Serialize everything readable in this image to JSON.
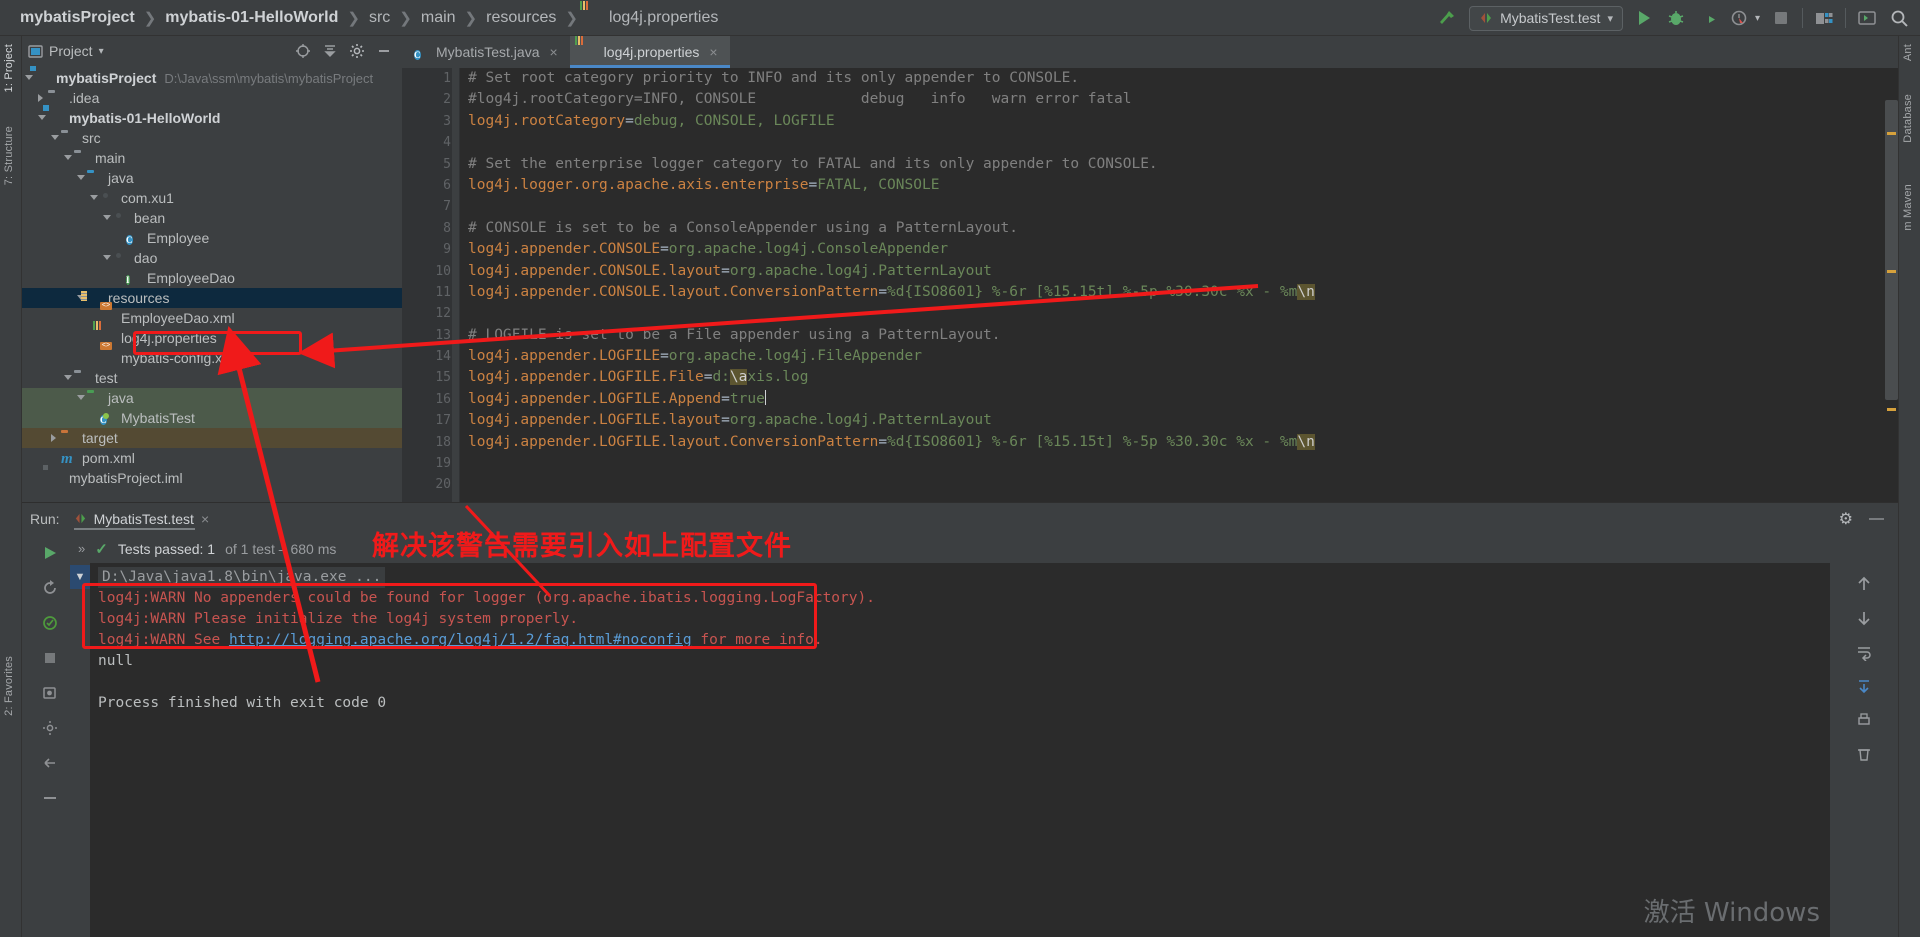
{
  "window": {
    "breadcrumbs": [
      {
        "label": "mybatisProject",
        "bold": true
      },
      {
        "label": "mybatis-01-HelloWorld",
        "bold": true
      },
      {
        "label": "src",
        "bold": false
      },
      {
        "label": "main",
        "bold": false
      },
      {
        "label": "resources",
        "bold": false
      },
      {
        "label": "log4j.properties",
        "bold": false,
        "icon": "properties-file-icon"
      }
    ],
    "separator": "❯"
  },
  "toolbar": {
    "build_label": "Build",
    "run_config": "MybatisTest.test",
    "dropdown_caret": "▾",
    "icons": [
      {
        "name": "build-hammer-icon",
        "color": "#4c9e4c"
      },
      {
        "name": "run-icon",
        "color": "#59a869"
      },
      {
        "name": "debug-icon",
        "color": "#59a869"
      },
      {
        "name": "run-with-coverage-icon",
        "color": "#8f9194"
      },
      {
        "name": "profiler-icon",
        "color": "#8f9194"
      },
      {
        "name": "stop-icon",
        "color": "#76797b"
      },
      {
        "name": "project-structure-icon",
        "color": "#8f9194"
      },
      {
        "name": "terminal-icon",
        "color": "#59a869"
      },
      {
        "name": "search-everywhere-icon",
        "color": "#b4b7ba"
      }
    ]
  },
  "left_strip": {
    "items": [
      {
        "label": "1: Project",
        "active": true
      },
      {
        "label": "7: Structure",
        "active": false
      },
      {
        "label": "2: Favorites",
        "active": false
      }
    ]
  },
  "right_strip": {
    "items": [
      {
        "label": "Ant",
        "active": false
      },
      {
        "label": "Database",
        "active": false
      },
      {
        "label": "m Maven",
        "active": false
      }
    ]
  },
  "project_panel": {
    "title": "Project",
    "title_caret": "▾",
    "actions": [
      {
        "name": "locate-icon",
        "glyph": "⊕"
      },
      {
        "name": "collapse-all-icon",
        "glyph": "⤓"
      },
      {
        "name": "settings-gear-icon",
        "glyph": "⚙"
      },
      {
        "name": "hide-panel-icon",
        "glyph": "—"
      }
    ],
    "tree": [
      {
        "indent": 0,
        "arrow": "down",
        "icon": "module-icon",
        "label": "mybatisProject",
        "bold": true,
        "path": "D:\\Java\\ssm\\mybatis\\mybatisProject",
        "sel": ""
      },
      {
        "indent": 1,
        "arrow": "right",
        "icon": "folder-icon",
        "label": ".idea",
        "bold": false,
        "path": "",
        "sel": ""
      },
      {
        "indent": 1,
        "arrow": "down",
        "icon": "module-icon",
        "label": "mybatis-01-HelloWorld",
        "bold": true,
        "path": "",
        "sel": ""
      },
      {
        "indent": 2,
        "arrow": "down",
        "icon": "folder-icon",
        "label": "src",
        "bold": false,
        "path": "",
        "sel": ""
      },
      {
        "indent": 3,
        "arrow": "down",
        "icon": "folder-icon",
        "label": "main",
        "bold": false,
        "path": "",
        "sel": ""
      },
      {
        "indent": 4,
        "arrow": "down",
        "icon": "source-folder-icon",
        "label": "java",
        "bold": false,
        "path": "",
        "sel": ""
      },
      {
        "indent": 5,
        "arrow": "down",
        "icon": "package-icon",
        "label": "com.xu1",
        "bold": false,
        "path": "",
        "sel": ""
      },
      {
        "indent": 6,
        "arrow": "down",
        "icon": "package-icon",
        "label": "bean",
        "bold": false,
        "path": "",
        "sel": ""
      },
      {
        "indent": 7,
        "arrow": "none",
        "icon": "java-class-icon",
        "label": "Employee",
        "bold": false,
        "path": "",
        "sel": ""
      },
      {
        "indent": 6,
        "arrow": "down",
        "icon": "package-icon",
        "label": "dao",
        "bold": false,
        "path": "",
        "sel": ""
      },
      {
        "indent": 7,
        "arrow": "none",
        "icon": "java-interface-icon",
        "label": "EmployeeDao",
        "bold": false,
        "path": "",
        "sel": ""
      },
      {
        "indent": 4,
        "arrow": "down",
        "icon": "resources-folder-icon",
        "label": "resources",
        "bold": false,
        "path": "",
        "sel": "blue"
      },
      {
        "indent": 5,
        "arrow": "none",
        "icon": "xml-file-icon",
        "label": "EmployeeDao.xml",
        "bold": false,
        "path": "",
        "sel": ""
      },
      {
        "indent": 5,
        "arrow": "none",
        "icon": "properties-file-icon",
        "label": "log4j.properties",
        "bold": false,
        "path": "",
        "sel": ""
      },
      {
        "indent": 5,
        "arrow": "none",
        "icon": "xml-file-icon",
        "label": "mybatis-config.xml",
        "bold": false,
        "path": "",
        "sel": ""
      },
      {
        "indent": 3,
        "arrow": "down",
        "icon": "folder-icon",
        "label": "test",
        "bold": false,
        "path": "",
        "sel": ""
      },
      {
        "indent": 4,
        "arrow": "down",
        "icon": "test-source-folder-icon",
        "label": "java",
        "bold": false,
        "path": "",
        "sel": "green"
      },
      {
        "indent": 5,
        "arrow": "none",
        "icon": "test-class-icon",
        "label": "MybatisTest",
        "bold": false,
        "path": "",
        "sel": "green"
      },
      {
        "indent": 2,
        "arrow": "right",
        "icon": "target-folder-icon",
        "label": "target",
        "bold": false,
        "path": "",
        "sel": "brown"
      },
      {
        "indent": 2,
        "arrow": "none",
        "icon": "maven-pom-icon",
        "label": "pom.xml",
        "bold": false,
        "path": "",
        "sel": ""
      },
      {
        "indent": 1,
        "arrow": "none",
        "icon": "iml-file-icon",
        "label": "mybatisProject.iml",
        "bold": false,
        "path": "",
        "sel": ""
      }
    ]
  },
  "editor": {
    "tabs": [
      {
        "label": "MybatisTest.java",
        "icon": "java-class-icon",
        "active": false,
        "close": "×"
      },
      {
        "label": "log4j.properties",
        "icon": "properties-file-icon",
        "active": true,
        "close": "×"
      }
    ],
    "line_numbers": [
      1,
      2,
      3,
      4,
      5,
      6,
      7,
      8,
      9,
      10,
      11,
      12,
      13,
      14,
      15,
      16,
      17,
      18,
      19,
      20
    ],
    "lines": [
      {
        "n": 1,
        "tokens": [
          {
            "t": "comment",
            "v": "# Set root category priority to INFO and its only appender to CONSOLE."
          }
        ]
      },
      {
        "n": 2,
        "tokens": [
          {
            "t": "comment",
            "v": "#log4j.rootCategory=INFO, CONSOLE            debug   info   warn error fatal"
          }
        ]
      },
      {
        "n": 3,
        "tokens": [
          {
            "t": "key",
            "v": "log4j.rootCategory"
          },
          {
            "t": "eq",
            "v": "="
          },
          {
            "t": "val",
            "v": "debug, CONSOLE, LOGFILE"
          }
        ]
      },
      {
        "n": 4,
        "tokens": []
      },
      {
        "n": 5,
        "tokens": [
          {
            "t": "comment",
            "v": "# Set the enterprise logger category to FATAL and its only appender to CONSOLE."
          }
        ]
      },
      {
        "n": 6,
        "tokens": [
          {
            "t": "key",
            "v": "log4j.logger.org.apache.axis.enterprise"
          },
          {
            "t": "eq",
            "v": "="
          },
          {
            "t": "val",
            "v": "FATAL, CONSOLE"
          }
        ]
      },
      {
        "n": 7,
        "tokens": []
      },
      {
        "n": 8,
        "tokens": [
          {
            "t": "comment",
            "v": "# CONSOLE is set to be a ConsoleAppender using a PatternLayout."
          }
        ]
      },
      {
        "n": 9,
        "tokens": [
          {
            "t": "key",
            "v": "log4j.appender.CONSOLE"
          },
          {
            "t": "eq",
            "v": "="
          },
          {
            "t": "val",
            "v": "org.apache.log4j.ConsoleAppender"
          }
        ]
      },
      {
        "n": 10,
        "tokens": [
          {
            "t": "key",
            "v": "log4j.appender.CONSOLE.layout"
          },
          {
            "t": "eq",
            "v": "="
          },
          {
            "t": "val",
            "v": "org.apache.log4j.PatternLayout"
          }
        ]
      },
      {
        "n": 11,
        "tokens": [
          {
            "t": "key",
            "v": "log4j.appender.CONSOLE.layout.ConversionPattern"
          },
          {
            "t": "eq",
            "v": "="
          },
          {
            "t": "val",
            "v": "%d{ISO8601} %-6r [%15.15t] %-5p %30.30c %x - %m"
          },
          {
            "t": "esc",
            "v": "\\n"
          }
        ]
      },
      {
        "n": 12,
        "tokens": []
      },
      {
        "n": 13,
        "tokens": [
          {
            "t": "comment",
            "v": "# LOGFILE is set to be a File appender using a PatternLayout."
          }
        ]
      },
      {
        "n": 14,
        "tokens": [
          {
            "t": "key",
            "v": "log4j.appender.LOGFILE"
          },
          {
            "t": "eq",
            "v": "="
          },
          {
            "t": "val",
            "v": "org.apache.log4j.FileAppender"
          }
        ]
      },
      {
        "n": 15,
        "tokens": [
          {
            "t": "key",
            "v": "log4j.appender.LOGFILE.File"
          },
          {
            "t": "eq",
            "v": "="
          },
          {
            "t": "val",
            "v": "d:"
          },
          {
            "t": "esc",
            "v": "\\a"
          },
          {
            "t": "val",
            "v": "xis.log"
          }
        ]
      },
      {
        "n": 16,
        "tokens": [
          {
            "t": "key",
            "v": "log4j.appender.LOGFILE.Append"
          },
          {
            "t": "eq",
            "v": "="
          },
          {
            "t": "val",
            "v": "true"
          },
          {
            "t": "caret",
            "v": ""
          }
        ]
      },
      {
        "n": 17,
        "tokens": [
          {
            "t": "key",
            "v": "log4j.appender.LOGFILE.layout"
          },
          {
            "t": "eq",
            "v": "="
          },
          {
            "t": "val",
            "v": "org.apache.log4j.PatternLayout"
          }
        ]
      },
      {
        "n": 18,
        "tokens": [
          {
            "t": "key",
            "v": "log4j.appender.LOGFILE.layout.ConversionPattern"
          },
          {
            "t": "eq",
            "v": "="
          },
          {
            "t": "val",
            "v": "%d{ISO8601} %-6r [%15.15t] %-5p %30.30c %x - %m"
          },
          {
            "t": "esc",
            "v": "\\n"
          }
        ]
      },
      {
        "n": 19,
        "tokens": []
      },
      {
        "n": 20,
        "tokens": []
      }
    ]
  },
  "run_panel": {
    "run_label": "Run:",
    "tab_label": "MybatisTest.test",
    "tab_close": "×",
    "settings_icon_glyph": "⚙",
    "minimize_icon_glyph": "—",
    "test_status": {
      "chevron": "»",
      "check": "✓",
      "main": "Tests passed: 1",
      "dim": "of 1 test – 680 ms"
    },
    "console": [
      {
        "type": "cmd",
        "text": "D:\\Java\\java1.8\\bin\\java.exe ..."
      },
      {
        "type": "warn",
        "text": "log4j:WARN No appenders could be found for logger (org.apache.ibatis.logging.LogFactory)."
      },
      {
        "type": "warn",
        "text": "log4j:WARN Please initialize the log4j system properly."
      },
      {
        "type": "warn-link",
        "prefix": "log4j:WARN See ",
        "link": "http://logging.apache.org/log4j/1.2/faq.html#noconfig",
        "suffix": " for more info."
      },
      {
        "type": "normal",
        "text": "null"
      },
      {
        "type": "blank",
        "text": ""
      },
      {
        "type": "normal",
        "text": "Process finished with exit code 0"
      }
    ],
    "left_icons": [
      {
        "name": "rerun-icon",
        "glyph": "▶"
      },
      {
        "name": "rerun-failed-icon",
        "glyph": "↺"
      },
      {
        "name": "toggle-auto-test-icon",
        "glyph": "⧉"
      },
      {
        "name": "stop-icon",
        "glyph": "■"
      },
      {
        "name": "export-icon",
        "glyph": "❐"
      },
      {
        "name": "settings-icon",
        "glyph": "⚙"
      },
      {
        "name": "pin-icon",
        "glyph": "↲"
      },
      {
        "name": "close-icon",
        "glyph": "━"
      }
    ],
    "right_icons": [
      {
        "name": "scroll-up-icon",
        "glyph": "↑"
      },
      {
        "name": "scroll-down-icon",
        "glyph": "↓"
      },
      {
        "name": "soft-wrap-icon",
        "glyph": "↵"
      },
      {
        "name": "scroll-to-end-icon",
        "glyph": "⤓"
      },
      {
        "name": "print-icon",
        "glyph": "⎙"
      },
      {
        "name": "clear-all-icon",
        "glyph": "🗑"
      }
    ]
  },
  "annotations": {
    "note_text": "解决该警告需要引入如上配置文件",
    "color": "#f01a1a",
    "watermark": "激活 Windows"
  }
}
